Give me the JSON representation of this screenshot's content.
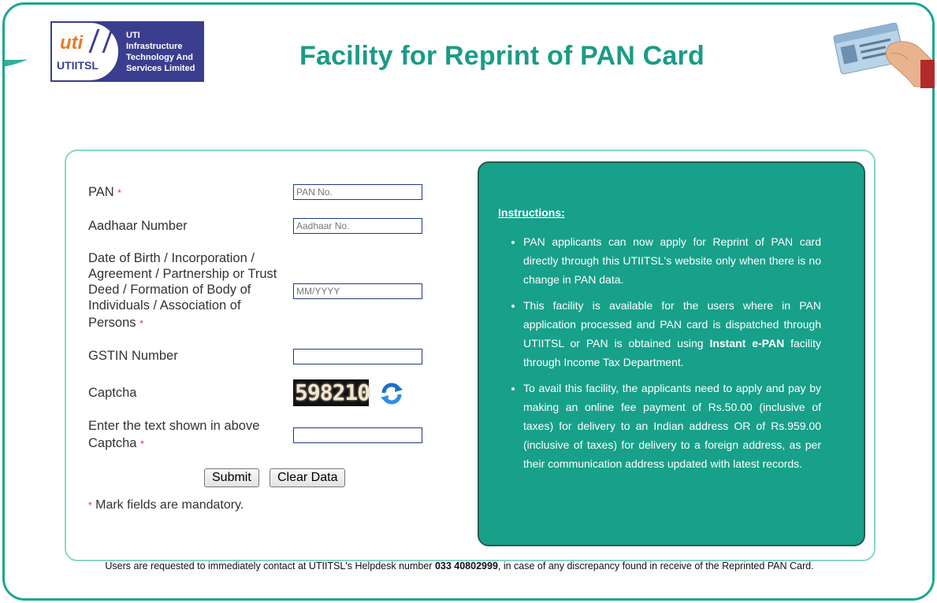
{
  "header": {
    "logo": {
      "mark_text": "uti",
      "brand_name": "UTIITSL",
      "company_line1": "UTI Infrastructure",
      "company_line2": "Technology And",
      "company_line3": "Services Limited"
    },
    "title": "Facility for Reprint of PAN Card",
    "illustration_icon": "pan-card-hand-icon"
  },
  "form": {
    "pan_label": "PAN",
    "pan_placeholder": "PAN No.",
    "aadhaar_label": "Aadhaar Number",
    "aadhaar_placeholder": "Aadhaar No.",
    "dob_label_line1": "Date of Birth / Incorporation /",
    "dob_label_line2": "Agreement / Partnership or Trust",
    "dob_label_line3": "Deed / Formation of Body of",
    "dob_label_line4": "Individuals / Association of",
    "dob_label_line5": "Persons",
    "dob_placeholder": "MM/YYYY",
    "gstin_label": "GSTIN Number",
    "captcha_label": "Captcha",
    "captcha_value": "598210",
    "captcha_entry_label_line1": "Enter the text shown in above",
    "captcha_entry_label_line2": "Captcha",
    "required_marker": "*",
    "submit_label": "Submit",
    "clear_label": "Clear Data",
    "mandatory_note": "Mark fields are mandatory."
  },
  "instructions": {
    "title": "Instructions:",
    "items": [
      "PAN applicants can now apply for Reprint of PAN card directly through this UTIITSL's website only when there is no change in PAN data.",
      "To avail this facility, the applicants need to apply and pay by making an online fee payment of Rs.50.00 (inclusive of taxes) for delivery to an Indian address OR of Rs.959.00 (inclusive of taxes) for delivery to a foreign address, as per their communication address updated with latest records."
    ],
    "item2_part1": "This facility is available for the users where in PAN application processed and PAN card is dispatched through UTIITSL or PAN is obtained using",
    "item2_bold": "Instant e-PAN",
    "item2_part2": "facility through Income Tax Department."
  },
  "footer": {
    "text_before": "Users are requested to immediately contact at UTIITSL's Helpdesk number",
    "helpdesk_number": "033 40802999",
    "text_after": ", in case of any discrepancy found in receive of the Reprinted PAN Card."
  },
  "colors": {
    "brand_teal": "#1aa791",
    "title_teal": "#1b9b86",
    "logo_blue": "#3b3d8f",
    "required_red": "#dd3333"
  }
}
